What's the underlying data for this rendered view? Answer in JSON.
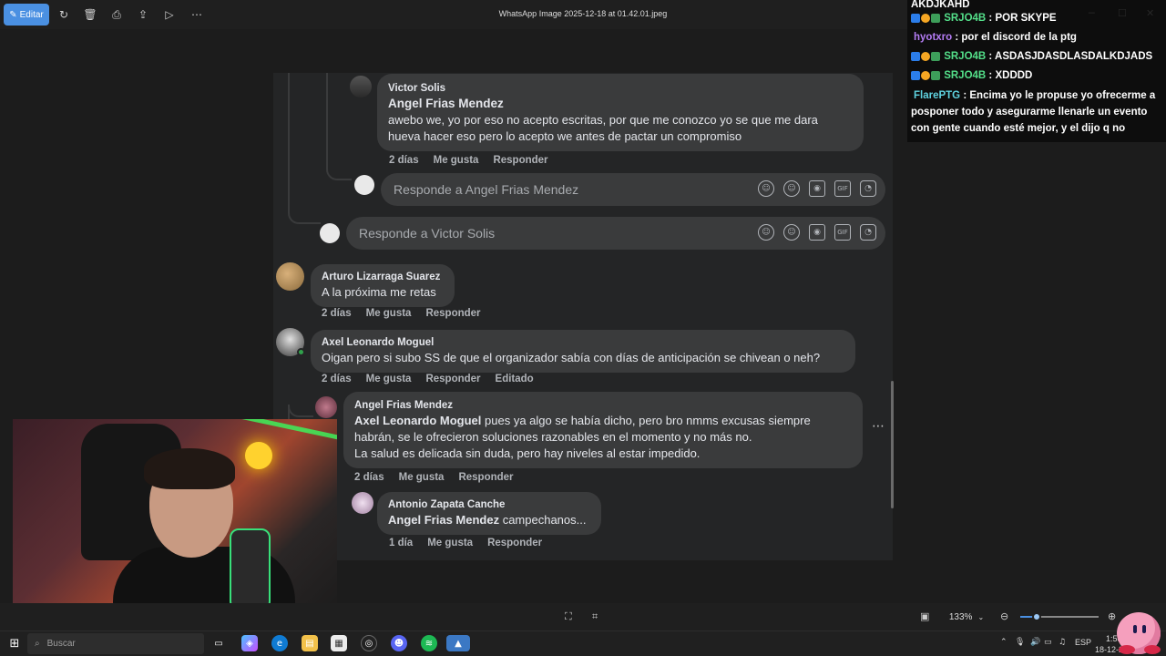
{
  "toolbar": {
    "edit_label": "Editar",
    "window_title": "WhatsApp Image 2025-12-18 at 01.42.01.jpeg"
  },
  "chat": {
    "top_line": "AKDJKAHD",
    "messages": [
      {
        "user": "SRJO4B",
        "text": "POR SKYPE",
        "color": "#54e08a"
      },
      {
        "user": "hyotxro",
        "text": "por el discord de la ptg",
        "color": "#b47cf4"
      },
      {
        "user": "SRJO4B",
        "text": "ASDASJDASDLASDALKDJADS",
        "color": "#54e08a"
      },
      {
        "user": "SRJO4B",
        "text": "XDDDD",
        "color": "#54e08a"
      },
      {
        "user": "FlarePTG",
        "text": "Encima yo le propuse yo ofrecerme a posponer todo y asegurarme llenarle un evento con gente cuando esté mejor, y el dijo q no",
        "color": "#5fd3e0"
      }
    ]
  },
  "comments": {
    "victor": {
      "author": "Victor Solis",
      "mention": "Angel Frias Mendez",
      "text": "awebo we, yo por eso no acepto escritas, por que me conozco yo se que me dara hueva hacer eso pero lo acepto we antes de pactar un compromiso",
      "time": "2 días",
      "like": "Me gusta",
      "reply": "Responder"
    },
    "reply_angel_placeholder": "Responde a Angel Frias Mendez",
    "reply_victor_placeholder": "Responde a Victor Solis",
    "arturo": {
      "author": "Arturo Lizarraga Suarez",
      "text": "A la próxima me retas",
      "time": "2 días",
      "like": "Me gusta",
      "reply": "Responder"
    },
    "axel": {
      "author": "Axel Leonardo Moguel",
      "text": "Oigan pero si subo SS de que el organizador sabía con días de anticipación se chivean o neh?",
      "time": "2 días",
      "like": "Me gusta",
      "reply": "Responder",
      "edited": "Editado"
    },
    "angel": {
      "author": "Angel Frias Mendez",
      "mention": "Axel Leonardo Moguel",
      "text": " pues ya algo se había dicho, pero bro nmms excusas siempre habrán, se le ofrecieron soluciones razonables en el momento y no más no.",
      "text2": "La salud es delicada sin duda, pero hay niveles al estar impedido.",
      "time": "2 días",
      "like": "Me gusta",
      "reply": "Responder"
    },
    "antonio": {
      "author": "Antonio Zapata Canche",
      "mention": "Angel Frias Mendez",
      "text": " campechanos...",
      "time": "1 día",
      "like": "Me gusta",
      "reply": "Responder"
    }
  },
  "viewer": {
    "zoom": "133%",
    "zoom_level_fraction": 0.2
  },
  "taskbar": {
    "search_placeholder": "Buscar",
    "language": "ESP",
    "time": "1:58",
    "date": "18-12-2"
  }
}
